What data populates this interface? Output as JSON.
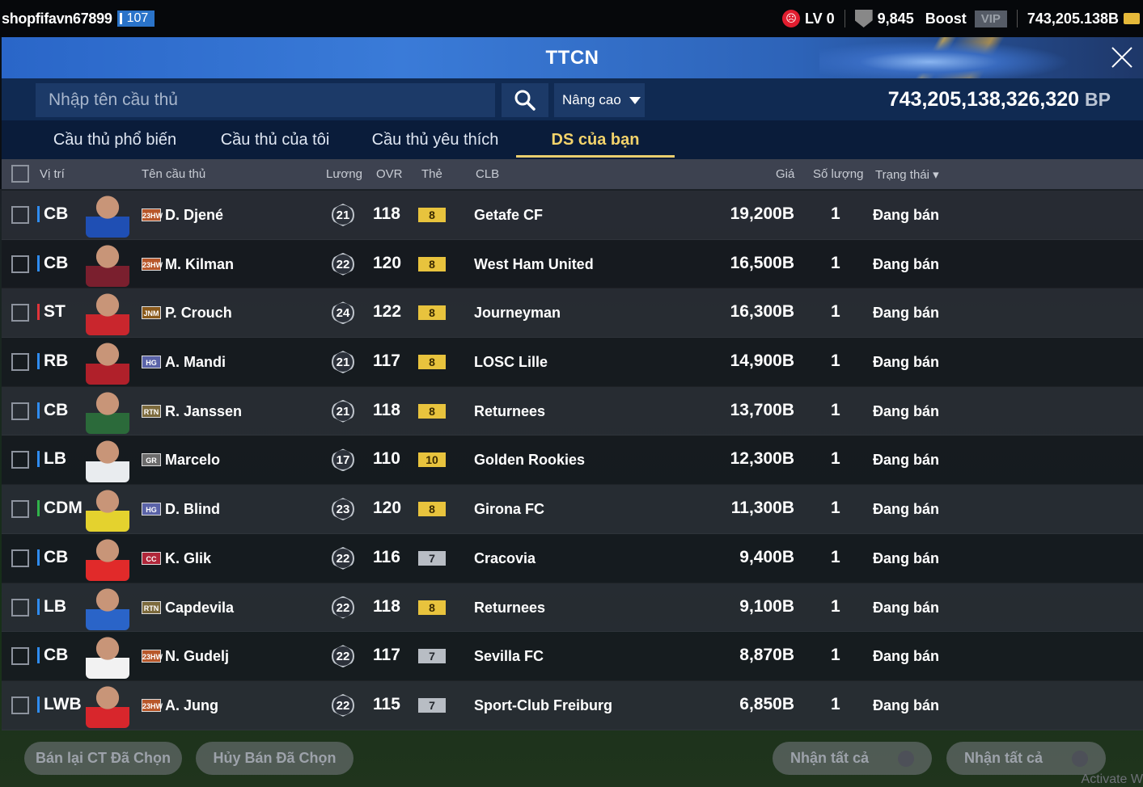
{
  "topbar": {
    "username": "shopfifavn67899",
    "level": "107",
    "lv_label": "LV 0",
    "shield_count": "9,845",
    "boost_label": "Boost",
    "vip_label": "VIP",
    "coins": "743,205.138B"
  },
  "header": {
    "title": "TTCN"
  },
  "search": {
    "placeholder": "Nhập tên cầu thủ",
    "advanced_label": "Nâng cao",
    "bp_value": "743,205,138,326,320",
    "bp_unit": "BP"
  },
  "tabs": [
    {
      "label": "Cầu thủ phổ biến",
      "active": false
    },
    {
      "label": "Cầu thủ của tôi",
      "active": false
    },
    {
      "label": "Cầu thủ yêu thích",
      "active": false
    },
    {
      "label": "DS của bạn",
      "active": true
    }
  ],
  "columns": {
    "position": "Vị trí",
    "name": "Tên cầu thủ",
    "salary": "Lương",
    "ovr": "OVR",
    "grade": "Thẻ",
    "club": "CLB",
    "price": "Giá",
    "quantity": "Số lượng",
    "status": "Trạng thái"
  },
  "rows": [
    {
      "pos": "CB",
      "pos_color": "#2f8cf0",
      "season": "23HW",
      "season_color": "#b8572a",
      "name": "D. Djené",
      "salary": "21",
      "ovr": "118",
      "grade": "8",
      "grade_tier": "gold",
      "club": "Getafe CF",
      "price": "19,200B",
      "qty": "1",
      "status": "Đang bán",
      "kit": "#1f4fb4"
    },
    {
      "pos": "CB",
      "pos_color": "#2f8cf0",
      "season": "23HW",
      "season_color": "#b8572a",
      "name": "M. Kilman",
      "salary": "22",
      "ovr": "120",
      "grade": "8",
      "grade_tier": "gold",
      "club": "West Ham United",
      "price": "16,500B",
      "qty": "1",
      "status": "Đang bán",
      "kit": "#7a1f2e"
    },
    {
      "pos": "ST",
      "pos_color": "#e0333a",
      "season": "JNM",
      "season_color": "#8a5a1c",
      "name": "P. Crouch",
      "salary": "24",
      "ovr": "122",
      "grade": "8",
      "grade_tier": "gold",
      "club": "Journeyman",
      "price": "16,300B",
      "qty": "1",
      "status": "Đang bán",
      "kit": "#c9262d"
    },
    {
      "pos": "RB",
      "pos_color": "#2f8cf0",
      "season": "HG",
      "season_color": "#5a63a8",
      "name": "A. Mandi",
      "salary": "21",
      "ovr": "117",
      "grade": "8",
      "grade_tier": "gold",
      "club": "LOSC Lille",
      "price": "14,900B",
      "qty": "1",
      "status": "Đang bán",
      "kit": "#b0202a"
    },
    {
      "pos": "CB",
      "pos_color": "#2f8cf0",
      "season": "RTN",
      "season_color": "#7c6a3c",
      "name": "R. Janssen",
      "salary": "21",
      "ovr": "118",
      "grade": "8",
      "grade_tier": "gold",
      "club": "Returnees",
      "price": "13,700B",
      "qty": "1",
      "status": "Đang bán",
      "kit": "#2b6a3a"
    },
    {
      "pos": "LB",
      "pos_color": "#2f8cf0",
      "season": "GR",
      "season_color": "#6b6b6b",
      "name": "Marcelo",
      "salary": "17",
      "ovr": "110",
      "grade": "10",
      "grade_tier": "gold",
      "club": "Golden Rookies",
      "price": "12,300B",
      "qty": "1",
      "status": "Đang bán",
      "kit": "#e9ecef"
    },
    {
      "pos": "CDM",
      "pos_color": "#30b34a",
      "season": "HG",
      "season_color": "#5a63a8",
      "name": "D. Blind",
      "salary": "23",
      "ovr": "120",
      "grade": "8",
      "grade_tier": "gold",
      "club": "Girona FC",
      "price": "11,300B",
      "qty": "1",
      "status": "Đang bán",
      "kit": "#e4d22e"
    },
    {
      "pos": "CB",
      "pos_color": "#2f8cf0",
      "season": "CC",
      "season_color": "#b0273a",
      "name": "K. Glik",
      "salary": "22",
      "ovr": "116",
      "grade": "7",
      "grade_tier": "silver",
      "club": "Cracovia",
      "price": "9,400B",
      "qty": "1",
      "status": "Đang bán",
      "kit": "#e12a2a"
    },
    {
      "pos": "LB",
      "pos_color": "#2f8cf0",
      "season": "RTN",
      "season_color": "#7c6a3c",
      "name": "Capdevila",
      "salary": "22",
      "ovr": "118",
      "grade": "8",
      "grade_tier": "gold",
      "club": "Returnees",
      "price": "9,100B",
      "qty": "1",
      "status": "Đang bán",
      "kit": "#2a64c8"
    },
    {
      "pos": "CB",
      "pos_color": "#2f8cf0",
      "season": "23HW",
      "season_color": "#b8572a",
      "name": "N. Gudelj",
      "salary": "22",
      "ovr": "117",
      "grade": "7",
      "grade_tier": "silver",
      "club": "Sevilla FC",
      "price": "8,870B",
      "qty": "1",
      "status": "Đang bán",
      "kit": "#f2f2f2"
    },
    {
      "pos": "LWB",
      "pos_color": "#2f8cf0",
      "season": "23HW",
      "season_color": "#b8572a",
      "name": "A. Jung",
      "salary": "22",
      "ovr": "115",
      "grade": "7",
      "grade_tier": "silver",
      "club": "Sport-Club Freiburg",
      "price": "6,850B",
      "qty": "1",
      "status": "Đang bán",
      "kit": "#d8262c"
    }
  ],
  "footer": {
    "resell_label": "Bán lại CT Đã Chọn",
    "cancel_label": "Hủy Bán Đã Chọn",
    "receive_all_label_1": "Nhận tất cả",
    "receive_all_label_2": "Nhận tất cả",
    "watermark": "Activate W"
  }
}
